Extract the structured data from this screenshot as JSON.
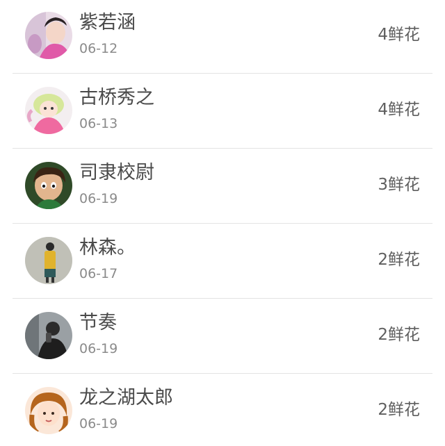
{
  "items": [
    {
      "name": "紫若涵",
      "date": "06-12",
      "flowers": "4鲜花"
    },
    {
      "name": "古桥秀之",
      "date": "06-13",
      "flowers": "4鲜花"
    },
    {
      "name": "司隶校尉",
      "date": "06-19",
      "flowers": "3鲜花"
    },
    {
      "name": "林森。",
      "date": "06-17",
      "flowers": "2鲜花"
    },
    {
      "name": "节奏",
      "date": "06-19",
      "flowers": "2鲜花"
    },
    {
      "name": "龙之湖太郎",
      "date": "06-19",
      "flowers": "2鲜花"
    }
  ]
}
